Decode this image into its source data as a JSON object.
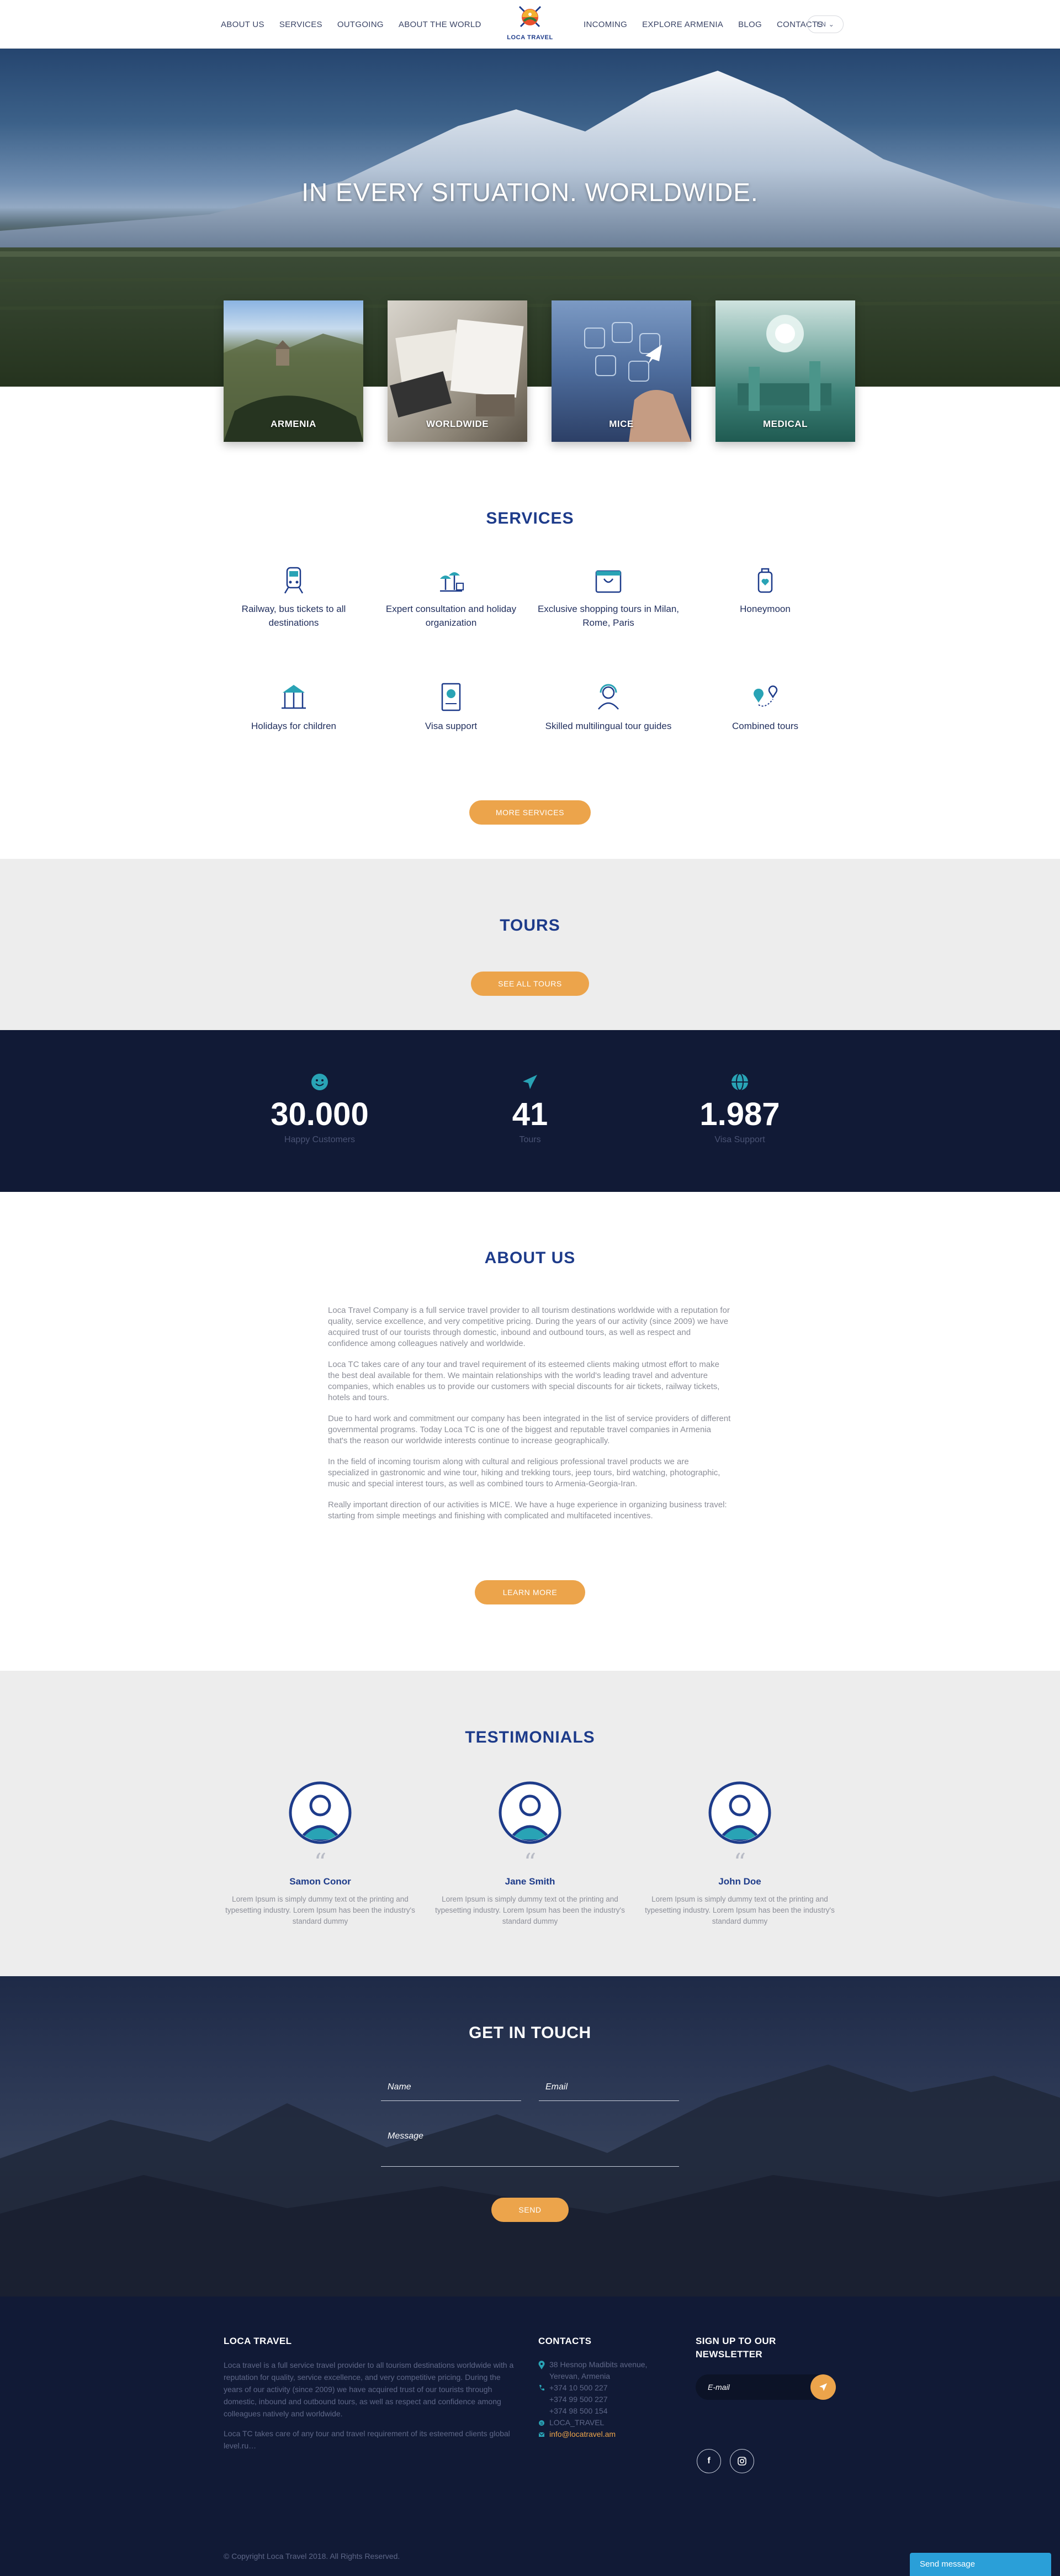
{
  "header": {
    "nav_left": [
      "ABOUT US",
      "SERVICES",
      "OUTGOING",
      "ABOUT THE WORLD"
    ],
    "nav_right": [
      "INCOMING",
      "EXPLORE ARMENIA",
      "BLOG",
      "CONTACTS"
    ],
    "logo_text": "LOCA TRAVEL",
    "language": "EN"
  },
  "hero": {
    "title": "IN EVERY SITUATION. WORLDWIDE.",
    "cards": [
      "ARMENIA",
      "WORLDWIDE",
      "MICE",
      "MEDICAL"
    ]
  },
  "services": {
    "title": "SERVICES",
    "items": [
      {
        "label": "Railway, bus tickets to all destinations",
        "icon": "train-icon"
      },
      {
        "label": "Expert consultation and holiday organization",
        "icon": "resort-icon"
      },
      {
        "label": "Exclusive shopping tours in Milan, Rome, Paris",
        "icon": "shopping-bag-icon"
      },
      {
        "label": "Honeymoon",
        "icon": "heart-luggage-icon"
      },
      {
        "label": "Holidays for children",
        "icon": "carousel-icon"
      },
      {
        "label": "Visa support",
        "icon": "passport-icon"
      },
      {
        "label": "Skilled multilingual tour guides",
        "icon": "guide-headset-icon"
      },
      {
        "label": "Combined tours",
        "icon": "route-pins-icon"
      }
    ],
    "more_button": "MORE SERVICES"
  },
  "tours": {
    "title": "TOURS",
    "button": "SEE ALL TOURS"
  },
  "stats": [
    {
      "value": "30.000",
      "label": "Happy Customers",
      "icon": "smiley-icon"
    },
    {
      "value": "41",
      "label": "Tours",
      "icon": "plane-icon"
    },
    {
      "value": "1.987",
      "label": "Visa Support",
      "icon": "globe-icon"
    }
  ],
  "about": {
    "title": "ABOUT US",
    "paragraphs": [
      "Loca Travel Company is a full service travel provider to all tourism destinations worldwide with a reputation for quality, service excellence, and very competitive pricing. During the years of our activity (since 2009) we have acquired trust of our tourists through domestic, inbound and outbound tours, as well as respect and confidence among colleagues natively and worldwide.",
      "Loca TC takes care of any tour and travel requirement of its esteemed clients making utmost effort to make the best deal available for them. We maintain relationships with the world's leading travel and adventure companies, which enables us to provide our customers with special discounts for air tickets, railway tickets, hotels and tours.",
      "Due to hard work and commitment our company has been integrated in the list of service providers of different governmental programs. Today Loca TC is one of the biggest and reputable travel companies in Armenia that's the reason our worldwide interests continue to increase geographically.",
      "In the field of incoming tourism along with cultural and religious professional travel products we are specialized in gastronomic and wine tour, hiking and trekking tours, jeep tours, bird watching, photographic, music and special interest tours, as well as combined tours to Armenia-Georgia-Iran.",
      "Really important direction of our activities is MICE. We have a huge experience in organizing business travel: starting from simple meetings and finishing with complicated and multifaceted incentives."
    ],
    "button": "LEARN MORE"
  },
  "testimonials": {
    "title": "TESTIMONIALS",
    "items": [
      {
        "name": "Samon Conor",
        "text": "Lorem Ipsum is simply dummy text ot the printing and typesetting industry. Lorem Ipsum has been the industry's standard dummy"
      },
      {
        "name": "Jane Smith",
        "text": "Lorem Ipsum is simply dummy text ot the printing and typesetting industry. Lorem Ipsum has been the industry's standard dummy"
      },
      {
        "name": "John Doe",
        "text": "Lorem Ipsum is simply dummy text ot the printing and typesetting industry. Lorem Ipsum has been the industry's standard dummy"
      }
    ]
  },
  "contact_form": {
    "title": "GET IN TOUCH",
    "name_placeholder": "Name",
    "email_placeholder": "Email",
    "message_placeholder": "Message",
    "send_button": "SEND"
  },
  "footer": {
    "about_title": "LOCA TRAVEL",
    "about_p1": "Loca travel is a full service travel provider to all tourism destinations worldwide with a reputation for quality, service excellence, and very competitive pricing. During the years of our activity (since 2009) we have acquired trust of our tourists through domestic, inbound and outbound tours, as well as respect and confidence among colleagues natively and worldwide.",
    "about_p2": "Loca TC takes care of any tour and travel requirement of its esteemed clients global level.ru…",
    "contacts_title": "CONTACTS",
    "address_line1": "38 Hesnop Madibits avenue,",
    "address_line2": "Yerevan, Armenia",
    "phones": [
      "+374 10 500 227",
      "+374 99 500 227",
      "+374 98 500 154"
    ],
    "skype": "LOCA_TRAVEL",
    "email": "info@locatravel.am",
    "newsletter_title": "SIGN UP TO OUR NEWSLETTER",
    "newsletter_placeholder": "E-mail",
    "copyright": "© Copyright Loca Travel 2018. All Rights Reserved.",
    "send_message": "Send message"
  },
  "colors": {
    "brand_blue": "#1d3b8a",
    "accent_orange": "#eca44b",
    "dark_navy": "#111a36",
    "teal_icon": "#29a3b5"
  }
}
